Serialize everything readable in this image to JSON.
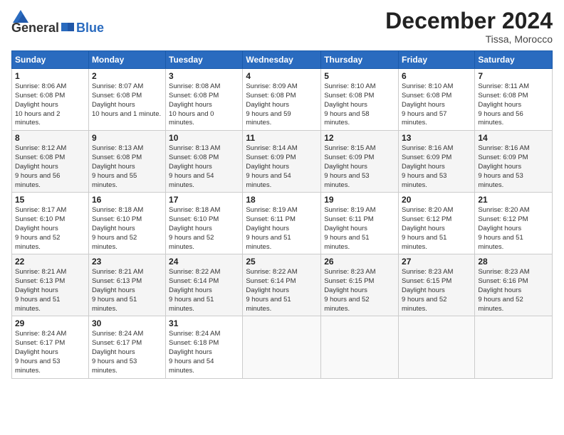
{
  "header": {
    "logo_general": "General",
    "logo_blue": "Blue",
    "month_title": "December 2024",
    "location": "Tissa, Morocco"
  },
  "days_of_week": [
    "Sunday",
    "Monday",
    "Tuesday",
    "Wednesday",
    "Thursday",
    "Friday",
    "Saturday"
  ],
  "weeks": [
    [
      {
        "day": "1",
        "sunrise": "8:06 AM",
        "sunset": "6:08 PM",
        "daylight": "10 hours and 2 minutes."
      },
      {
        "day": "2",
        "sunrise": "8:07 AM",
        "sunset": "6:08 PM",
        "daylight": "10 hours and 1 minute."
      },
      {
        "day": "3",
        "sunrise": "8:08 AM",
        "sunset": "6:08 PM",
        "daylight": "10 hours and 0 minutes."
      },
      {
        "day": "4",
        "sunrise": "8:09 AM",
        "sunset": "6:08 PM",
        "daylight": "9 hours and 59 minutes."
      },
      {
        "day": "5",
        "sunrise": "8:10 AM",
        "sunset": "6:08 PM",
        "daylight": "9 hours and 58 minutes."
      },
      {
        "day": "6",
        "sunrise": "8:10 AM",
        "sunset": "6:08 PM",
        "daylight": "9 hours and 57 minutes."
      },
      {
        "day": "7",
        "sunrise": "8:11 AM",
        "sunset": "6:08 PM",
        "daylight": "9 hours and 56 minutes."
      }
    ],
    [
      {
        "day": "8",
        "sunrise": "8:12 AM",
        "sunset": "6:08 PM",
        "daylight": "9 hours and 56 minutes."
      },
      {
        "day": "9",
        "sunrise": "8:13 AM",
        "sunset": "6:08 PM",
        "daylight": "9 hours and 55 minutes."
      },
      {
        "day": "10",
        "sunrise": "8:13 AM",
        "sunset": "6:08 PM",
        "daylight": "9 hours and 54 minutes."
      },
      {
        "day": "11",
        "sunrise": "8:14 AM",
        "sunset": "6:09 PM",
        "daylight": "9 hours and 54 minutes."
      },
      {
        "day": "12",
        "sunrise": "8:15 AM",
        "sunset": "6:09 PM",
        "daylight": "9 hours and 53 minutes."
      },
      {
        "day": "13",
        "sunrise": "8:16 AM",
        "sunset": "6:09 PM",
        "daylight": "9 hours and 53 minutes."
      },
      {
        "day": "14",
        "sunrise": "8:16 AM",
        "sunset": "6:09 PM",
        "daylight": "9 hours and 53 minutes."
      }
    ],
    [
      {
        "day": "15",
        "sunrise": "8:17 AM",
        "sunset": "6:10 PM",
        "daylight": "9 hours and 52 minutes."
      },
      {
        "day": "16",
        "sunrise": "8:18 AM",
        "sunset": "6:10 PM",
        "daylight": "9 hours and 52 minutes."
      },
      {
        "day": "17",
        "sunrise": "8:18 AM",
        "sunset": "6:10 PM",
        "daylight": "9 hours and 52 minutes."
      },
      {
        "day": "18",
        "sunrise": "8:19 AM",
        "sunset": "6:11 PM",
        "daylight": "9 hours and 51 minutes."
      },
      {
        "day": "19",
        "sunrise": "8:19 AM",
        "sunset": "6:11 PM",
        "daylight": "9 hours and 51 minutes."
      },
      {
        "day": "20",
        "sunrise": "8:20 AM",
        "sunset": "6:12 PM",
        "daylight": "9 hours and 51 minutes."
      },
      {
        "day": "21",
        "sunrise": "8:20 AM",
        "sunset": "6:12 PM",
        "daylight": "9 hours and 51 minutes."
      }
    ],
    [
      {
        "day": "22",
        "sunrise": "8:21 AM",
        "sunset": "6:13 PM",
        "daylight": "9 hours and 51 minutes."
      },
      {
        "day": "23",
        "sunrise": "8:21 AM",
        "sunset": "6:13 PM",
        "daylight": "9 hours and 51 minutes."
      },
      {
        "day": "24",
        "sunrise": "8:22 AM",
        "sunset": "6:14 PM",
        "daylight": "9 hours and 51 minutes."
      },
      {
        "day": "25",
        "sunrise": "8:22 AM",
        "sunset": "6:14 PM",
        "daylight": "9 hours and 51 minutes."
      },
      {
        "day": "26",
        "sunrise": "8:23 AM",
        "sunset": "6:15 PM",
        "daylight": "9 hours and 52 minutes."
      },
      {
        "day": "27",
        "sunrise": "8:23 AM",
        "sunset": "6:15 PM",
        "daylight": "9 hours and 52 minutes."
      },
      {
        "day": "28",
        "sunrise": "8:23 AM",
        "sunset": "6:16 PM",
        "daylight": "9 hours and 52 minutes."
      }
    ],
    [
      {
        "day": "29",
        "sunrise": "8:24 AM",
        "sunset": "6:17 PM",
        "daylight": "9 hours and 53 minutes."
      },
      {
        "day": "30",
        "sunrise": "8:24 AM",
        "sunset": "6:17 PM",
        "daylight": "9 hours and 53 minutes."
      },
      {
        "day": "31",
        "sunrise": "8:24 AM",
        "sunset": "6:18 PM",
        "daylight": "9 hours and 54 minutes."
      },
      null,
      null,
      null,
      null
    ]
  ]
}
